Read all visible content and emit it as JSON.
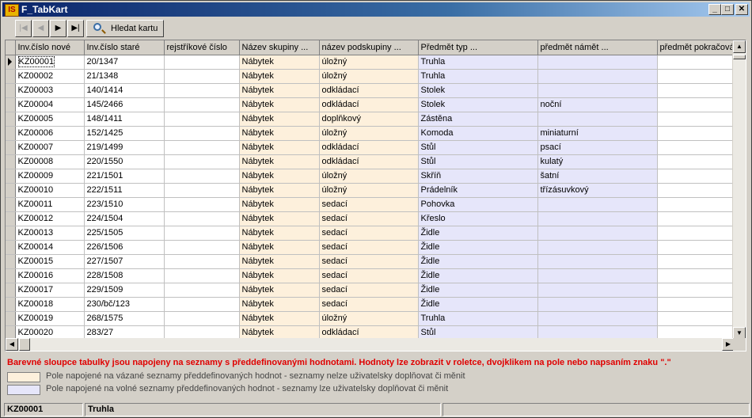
{
  "window": {
    "title": "F_TabKart",
    "icon_text": "IS",
    "minimize": "_",
    "maximize": "□",
    "close": "✕"
  },
  "toolbar": {
    "first": "|◀",
    "prev": "◀",
    "next": "▶",
    "last": "▶|",
    "search_label": "Hledat kartu"
  },
  "columns": [
    "Inv.číslo nové",
    "Inv.číslo staré",
    "rejstříkové číslo",
    "Název skupiny ...",
    "název podskupiny ...",
    "Předmět typ ...",
    "předmět námět ...",
    "předmět pokračování"
  ],
  "rows": [
    [
      "KZ00001",
      "20/1347",
      "",
      "Nábytek",
      "úložný",
      "Truhla",
      ""
    ],
    [
      "KZ00002",
      "21/1348",
      "",
      "Nábytek",
      "úložný",
      "Truhla",
      ""
    ],
    [
      "KZ00003",
      "140/1414",
      "",
      "Nábytek",
      "odkládací",
      "Stolek",
      ""
    ],
    [
      "KZ00004",
      "145/2466",
      "",
      "Nábytek",
      "odkládací",
      "Stolek",
      "noční"
    ],
    [
      "KZ00005",
      "148/1411",
      "",
      "Nábytek",
      "doplňkový",
      "Zástěna",
      ""
    ],
    [
      "KZ00006",
      "152/1425",
      "",
      "Nábytek",
      "úložný",
      "Komoda",
      "miniaturní"
    ],
    [
      "KZ00007",
      "219/1499",
      "",
      "Nábytek",
      "odkládací",
      "Stůl",
      "psací"
    ],
    [
      "KZ00008",
      "220/1550",
      "",
      "Nábytek",
      "odkládací",
      "Stůl",
      "kulatý"
    ],
    [
      "KZ00009",
      "221/1501",
      "",
      "Nábytek",
      "úložný",
      "Skříň",
      "šatní"
    ],
    [
      "KZ00010",
      "222/1511",
      "",
      "Nábytek",
      "úložný",
      "Prádelník",
      "třízásuvkový"
    ],
    [
      "KZ00011",
      "223/1510",
      "",
      "Nábytek",
      "sedací",
      "Pohovka",
      ""
    ],
    [
      "KZ00012",
      "224/1504",
      "",
      "Nábytek",
      "sedací",
      "Křeslo",
      ""
    ],
    [
      "KZ00013",
      "225/1505",
      "",
      "Nábytek",
      "sedací",
      "Židle",
      ""
    ],
    [
      "KZ00014",
      "226/1506",
      "",
      "Nábytek",
      "sedací",
      "Židle",
      ""
    ],
    [
      "KZ00015",
      "227/1507",
      "",
      "Nábytek",
      "sedací",
      "Židle",
      ""
    ],
    [
      "KZ00016",
      "228/1508",
      "",
      "Nábytek",
      "sedací",
      "Židle",
      ""
    ],
    [
      "KZ00017",
      "229/1509",
      "",
      "Nábytek",
      "sedací",
      "Židle",
      ""
    ],
    [
      "KZ00018",
      "230/bč/123",
      "",
      "Nábytek",
      "sedací",
      "Židle",
      ""
    ],
    [
      "KZ00019",
      "268/1575",
      "",
      "Nábytek",
      "úložný",
      "Truhla",
      ""
    ],
    [
      "KZ00020",
      "283/27",
      "",
      "Nábytek",
      "odkládací",
      "Stůl",
      ""
    ]
  ],
  "info_text": "Barevné sloupce tabulky jsou napojeny na seznamy s předdefinovanými hodnotami. Hodnoty lze zobrazit v roletce, dvojklikem na pole nebo napsaním znaku \".\"",
  "legend": [
    {
      "color": "#fdf0dc",
      "text": "Pole napojené na vázané seznamy předdefinovaných hodnot - seznamy nelze uživatelsky doplňovat či měnit"
    },
    {
      "color": "#e6e6fa",
      "text": " Pole napojené na volné seznamy předdefinovaných hodnot   - seznamy lze uživatelsky doplňovat či měnit"
    }
  ],
  "status": {
    "inv_no": "KZ00001",
    "subject": "Truhla"
  }
}
